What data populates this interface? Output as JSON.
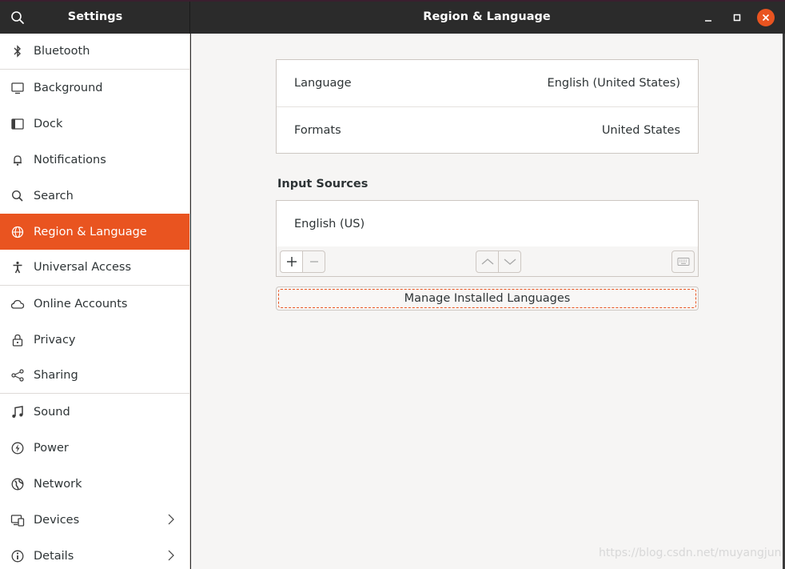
{
  "header": {
    "sidebar_title": "Settings",
    "window_title": "Region & Language"
  },
  "sidebar": {
    "items": [
      {
        "label": "Bluetooth",
        "icon": "bluetooth-icon"
      },
      {
        "label": "Background",
        "icon": "background-icon"
      },
      {
        "label": "Dock",
        "icon": "dock-icon"
      },
      {
        "label": "Notifications",
        "icon": "bell-icon"
      },
      {
        "label": "Search",
        "icon": "search-icon"
      },
      {
        "label": "Region & Language",
        "icon": "globe-icon",
        "active": true
      },
      {
        "label": "Universal Access",
        "icon": "accessibility-icon"
      },
      {
        "label": "Online Accounts",
        "icon": "cloud-icon"
      },
      {
        "label": "Privacy",
        "icon": "lock-icon"
      },
      {
        "label": "Sharing",
        "icon": "share-icon"
      },
      {
        "label": "Sound",
        "icon": "music-note-icon"
      },
      {
        "label": "Power",
        "icon": "power-icon"
      },
      {
        "label": "Network",
        "icon": "network-icon"
      },
      {
        "label": "Devices",
        "icon": "devices-icon",
        "chevron": true
      },
      {
        "label": "Details",
        "icon": "info-icon",
        "chevron": true
      }
    ]
  },
  "main": {
    "language_label": "Language",
    "language_value": "English (United States)",
    "formats_label": "Formats",
    "formats_value": "United States",
    "input_sources_label": "Input Sources",
    "input_sources": [
      "English (US)"
    ],
    "manage_button": "Manage Installed Languages"
  },
  "colors": {
    "accent": "#e95420",
    "headerbar": "#2b2b2b",
    "background": "#f6f5f4"
  },
  "watermark": "https://blog.csdn.net/muyangjun"
}
